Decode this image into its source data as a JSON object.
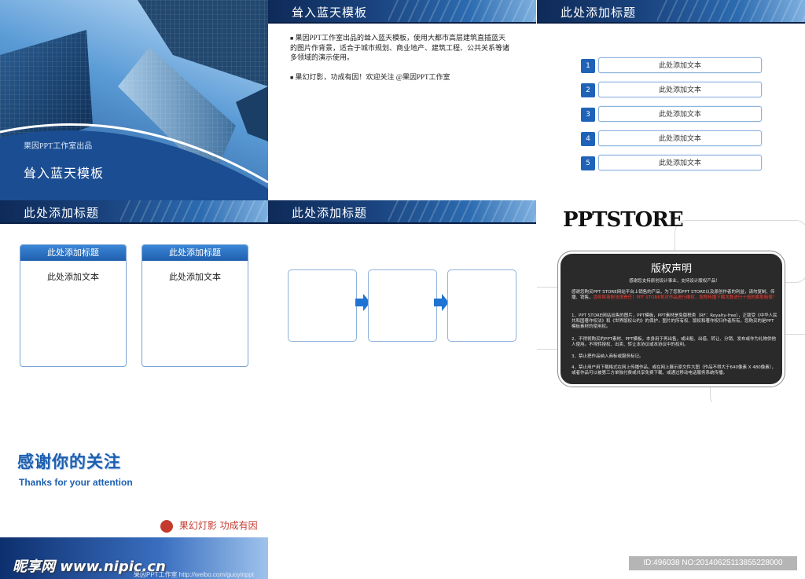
{
  "slide1": {
    "studio_label": "果因PPT工作室出品",
    "title": "耸入蓝天模板"
  },
  "slide2": {
    "header": "耸入蓝天模板",
    "bullet1": "果因PPT工作室出品的耸入蓝天模板，使用大都市高层建筑直插蓝天的图片作背景，适合于城市规划、商业地产、建筑工程、公共关系等诸多领域的演示使用。",
    "bullet2": "果幻灯影，功成有因！欢迎关注 @果因PPT工作室"
  },
  "slide3": {
    "header": "此处添加标题",
    "items": [
      {
        "num": "1",
        "text": "此处添加文本"
      },
      {
        "num": "2",
        "text": "此处添加文本"
      },
      {
        "num": "3",
        "text": "此处添加文本"
      },
      {
        "num": "4",
        "text": "此处添加文本"
      },
      {
        "num": "5",
        "text": "此处添加文本"
      }
    ]
  },
  "slide4": {
    "header": "此处添加标题",
    "cards": [
      {
        "title": "此处添加标题",
        "body": "此处添加文本"
      },
      {
        "title": "此处添加标题",
        "body": "此处添加文本"
      }
    ]
  },
  "slide5": {
    "header": "此处添加标题"
  },
  "slide6": {
    "logo": "PPTSTORE",
    "panel_title": "版权声明",
    "p1": "感谢您支持原创设计事业，支持设计版权产品！",
    "p2a": "感谢您购买PPT STORE网站平台上销售的产品，为了您和PPT STORE以及原创作者的利益，请勿复制、传播、销售，",
    "p2b": "否则将承担法律责任！PPT STORE将对作品进行维权，按照传播下载次数进行十倍的索取赔偿！",
    "p3": "1、PPT STORE网站出售的图片，PPT模板，PPT素材是免版税类（RF：Royalty-free），正版受《中华人民共和国著作权法》和《世界版权公约》的保护，图片的所有权、版权和著作权归作者所有，您购买的是PPT模板素材的使用权。",
    "p4": "2、不得将购买的PPT素材、PPT模板，本身用于再出售，或出租、出借、转让、分销、发布或作为礼物供他人使用。不得转授权、出卖、转让本协议或本协议中的权利。",
    "p5": "3、禁止把作品纳入商标或服务标记。",
    "p6": "4、禁止用户用下载格式在网上传播作品，或在网上展示原文件大图（作品不得大于640像素 X 480像素），或者作品可以被第三方单独付费或共享免费下载、或通过移动电话服务系统传播。"
  },
  "slide7": {
    "title_cn": "感谢你的关注",
    "title_en": "Thanks for your attention",
    "slogan": "果幻灯影 功成有因",
    "weibo": "果因PPT工作室 http://weibo.com/guoyinppt"
  },
  "watermark": {
    "site": "昵享网 www.nipic.cn",
    "id": "ID:496038 NO:20140625113855228000"
  },
  "colors": {
    "brand_blue": "#1f63b8",
    "header_dark": "#0e2a58",
    "title_blue": "#1c5fb0"
  }
}
